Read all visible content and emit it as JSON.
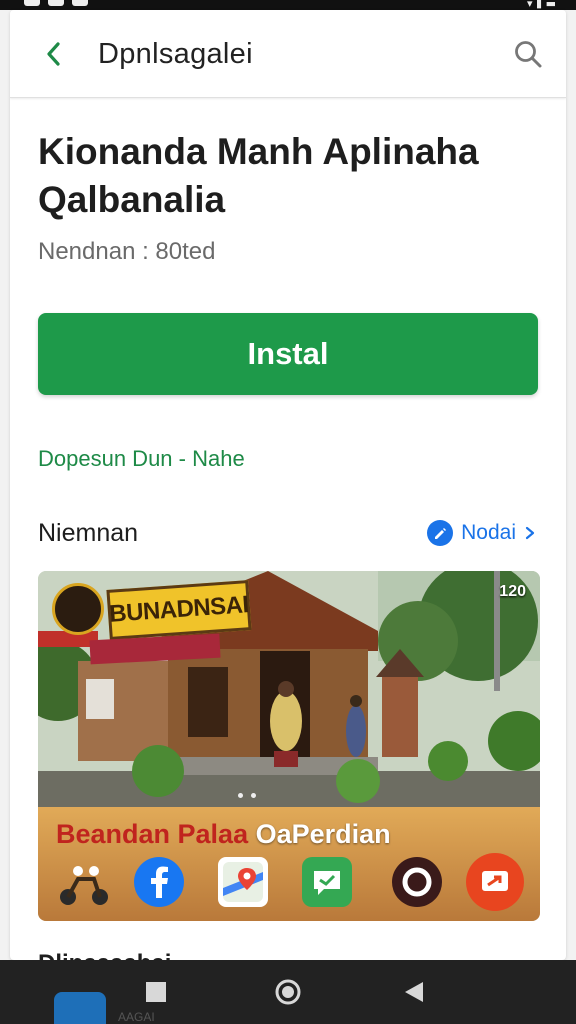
{
  "app_bar": {
    "title": "Dpnlsagalei",
    "back_icon": "chevron-left-icon",
    "search_icon": "search-icon"
  },
  "app": {
    "name": "Kionanda Manh Aplinaha Qalbanalia",
    "meta": "Nendnan : 80ted",
    "install_label": "Instal",
    "developer": "Dopesun Dun - Nahe"
  },
  "screenshots_section": {
    "title": "Niemnan",
    "more_label": "Nodai",
    "more_icon": "pencil-icon",
    "shot_sign": "BUNADNSAI",
    "shot_badge": "120",
    "banner_red": "Beandan Palaa ",
    "banner_white": "OaPerdian"
  },
  "next_section": {
    "title": "Dlinaaaahai"
  },
  "nav": {
    "app_label": "AAGAI"
  },
  "colors": {
    "accent_green": "#1e9a4a",
    "link_green": "#1e8a47",
    "link_blue": "#1a73e8"
  }
}
